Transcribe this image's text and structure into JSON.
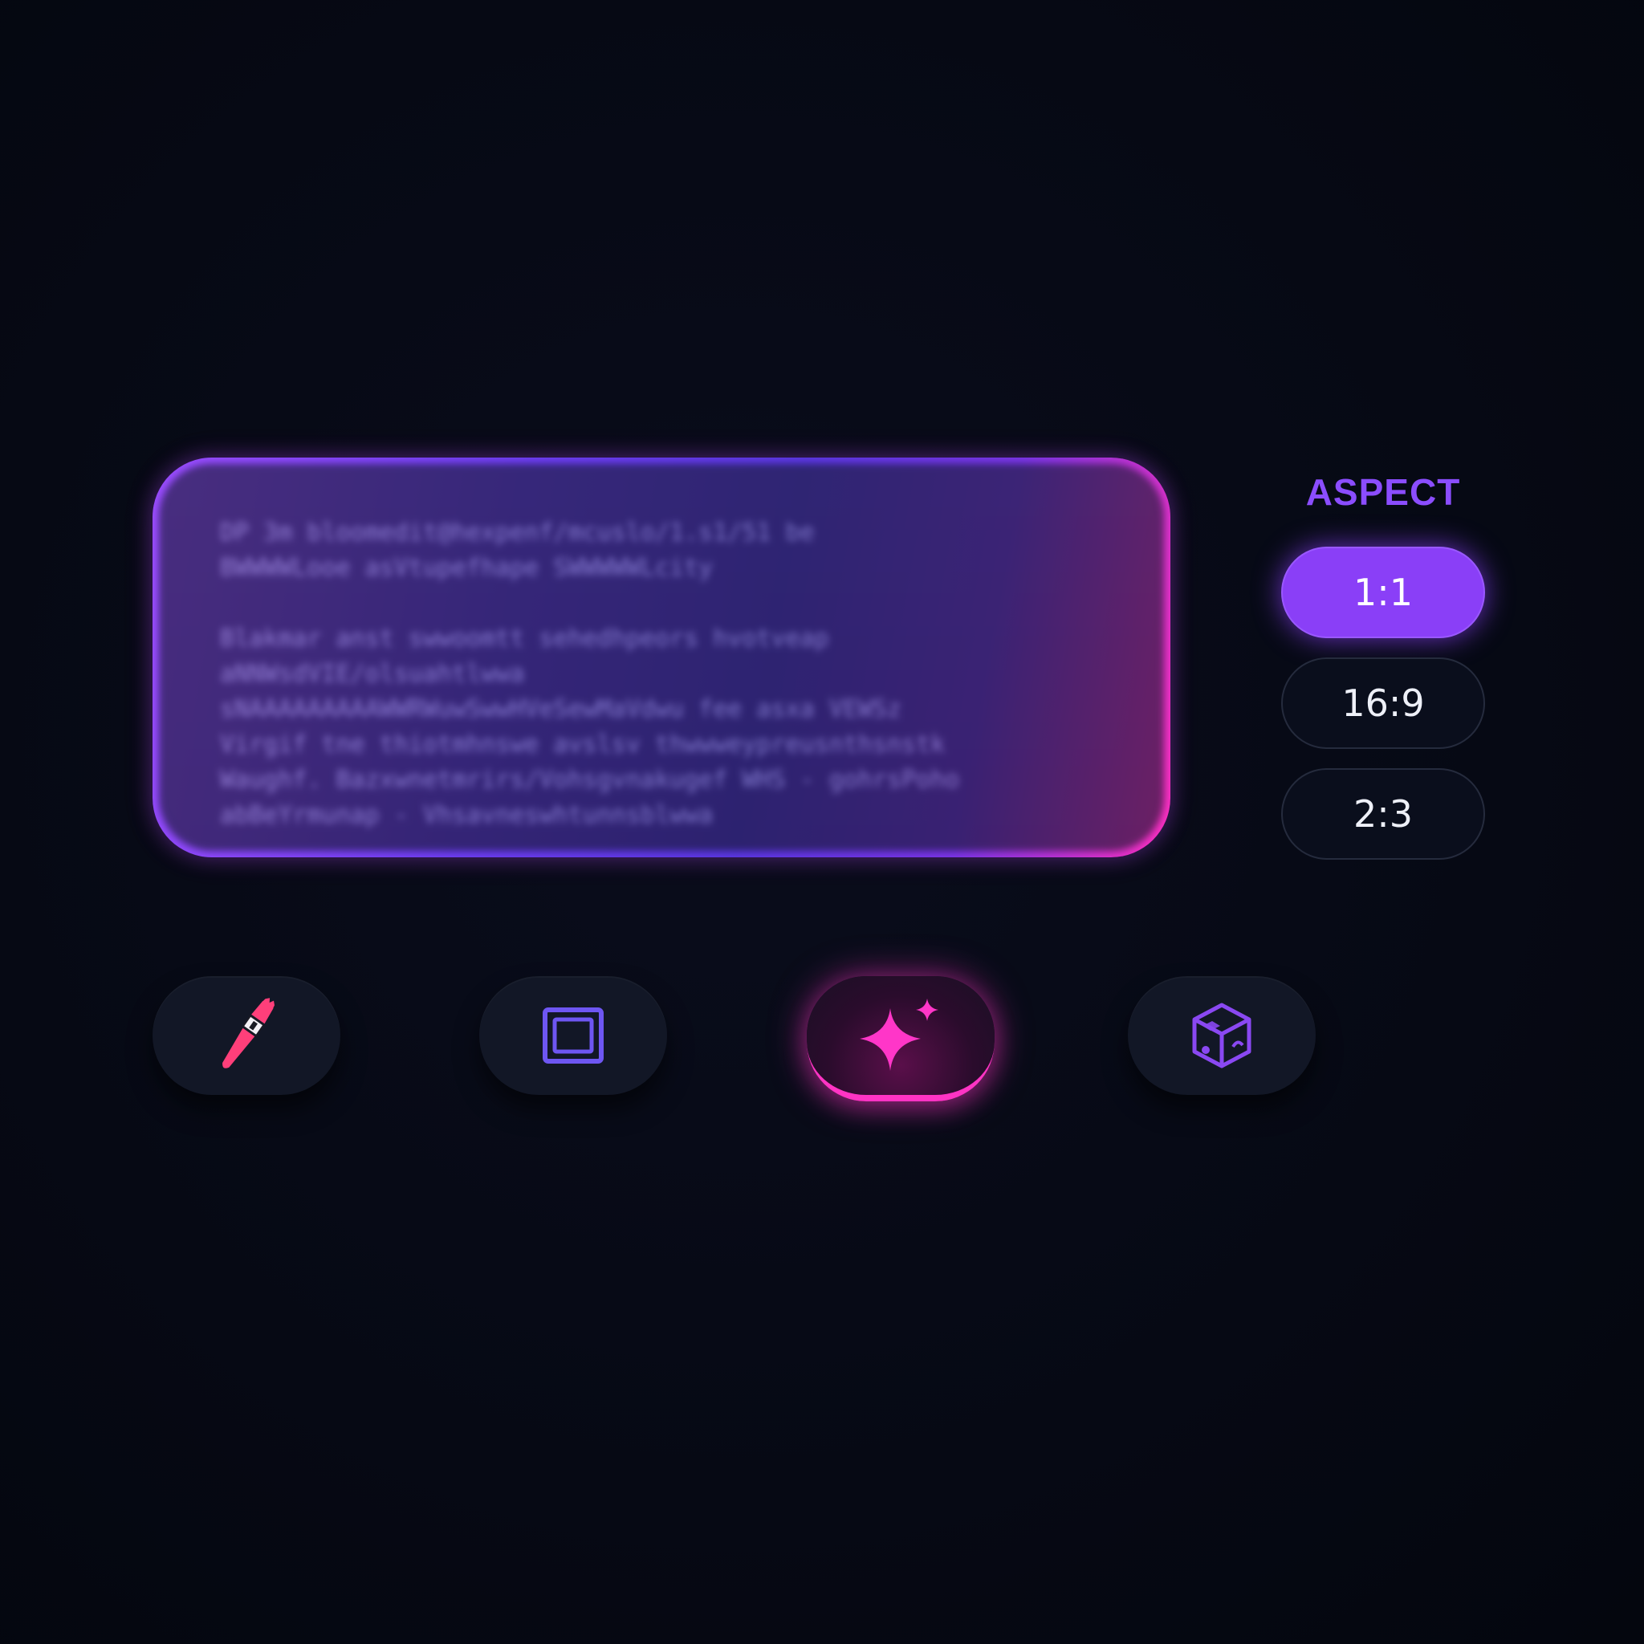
{
  "prompt": {
    "text": "DP 3m bloomedit@hexpenf/mcuslo/1.s1/51 be\nBWWWWLooe asVtupefhape SWWWWWLcity\n\nBlakmar anst swwoomtt sehedhpeors hvotveap aNNWsdVIE/olsuahtlwwa\nsNAAAAAAAAAWWRWuwSwwHVeSewMaVdwu fee asxa VEWSz\nVirgif tne thiotmhnswe avslsv thwwweypreusnthsnstk\nWaughf. Bazxwnetmrirs/Vohsgvnakugef WHS - gohrsPoho\nabBeYrmunap - Vhsavneswhtunnsblwwa"
  },
  "aspect": {
    "title": "ASPECT",
    "options": [
      {
        "label": "1:1",
        "selected": true
      },
      {
        "label": "16:9",
        "selected": false
      },
      {
        "label": "2:3",
        "selected": false
      }
    ]
  },
  "tools": [
    {
      "icon": "paintbrush-icon",
      "active": false
    },
    {
      "icon": "frame-icon",
      "active": false
    },
    {
      "icon": "sparkle-icon",
      "active": true
    },
    {
      "icon": "cube-icon",
      "active": false
    }
  ],
  "colors": {
    "accent_purple": "#8a3ff7",
    "accent_pink": "#ff34c4",
    "background": "#060914"
  }
}
